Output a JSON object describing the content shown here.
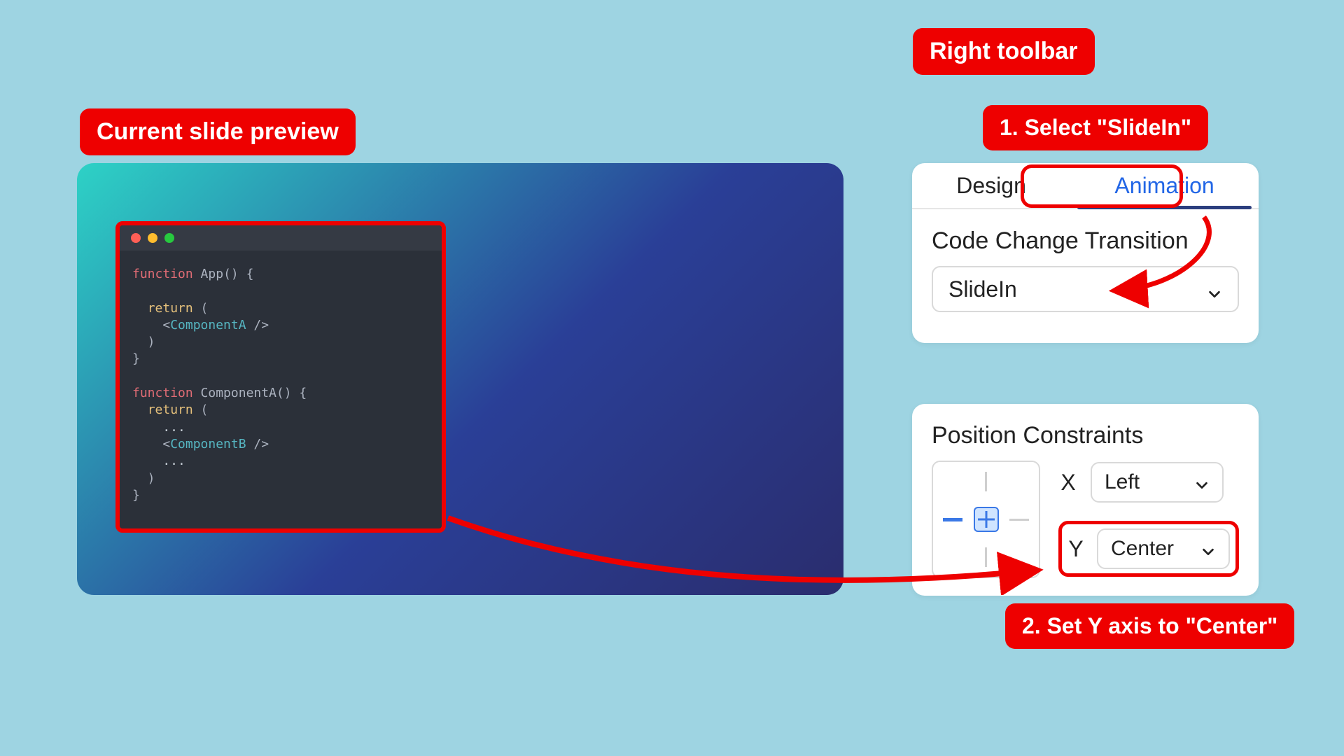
{
  "callouts": {
    "slide_preview": "Current slide preview",
    "right_toolbar": "Right toolbar",
    "step1": "1. Select \"SlideIn\"",
    "step2": "2. Set Y axis to \"Center\""
  },
  "slide": {
    "code_lines": [
      {
        "tokens": [
          {
            "t": "function",
            "c": "tok-kw"
          },
          {
            "t": " ",
            "c": ""
          },
          {
            "t": "App",
            "c": "tok-fn"
          },
          {
            "t": "() {",
            "c": "tok-pun"
          }
        ]
      },
      {
        "tokens": []
      },
      {
        "tokens": [
          {
            "t": "  ",
            "c": ""
          },
          {
            "t": "return",
            "c": "tok-ret"
          },
          {
            "t": " (",
            "c": "tok-pun"
          }
        ]
      },
      {
        "tokens": [
          {
            "t": "    <",
            "c": "tok-pun"
          },
          {
            "t": "ComponentA",
            "c": "tok-tag"
          },
          {
            "t": " />",
            "c": "tok-pun"
          }
        ]
      },
      {
        "tokens": [
          {
            "t": "  )",
            "c": "tok-pun"
          }
        ]
      },
      {
        "tokens": [
          {
            "t": "}",
            "c": "tok-pun"
          }
        ]
      },
      {
        "tokens": []
      },
      {
        "tokens": [
          {
            "t": "function",
            "c": "tok-kw"
          },
          {
            "t": " ",
            "c": ""
          },
          {
            "t": "ComponentA",
            "c": "tok-fn"
          },
          {
            "t": "() {",
            "c": "tok-pun"
          }
        ]
      },
      {
        "tokens": [
          {
            "t": "  ",
            "c": ""
          },
          {
            "t": "return",
            "c": "tok-ret"
          },
          {
            "t": " (",
            "c": "tok-pun"
          }
        ]
      },
      {
        "tokens": [
          {
            "t": "    ...",
            "c": "tok-dot"
          }
        ]
      },
      {
        "tokens": [
          {
            "t": "    <",
            "c": "tok-pun"
          },
          {
            "t": "ComponentB",
            "c": "tok-tag"
          },
          {
            "t": " />",
            "c": "tok-pun"
          }
        ]
      },
      {
        "tokens": [
          {
            "t": "    ...",
            "c": "tok-dot"
          }
        ]
      },
      {
        "tokens": [
          {
            "t": "  )",
            "c": "tok-pun"
          }
        ]
      },
      {
        "tokens": [
          {
            "t": "}",
            "c": "tok-pun"
          }
        ]
      }
    ]
  },
  "toolbar": {
    "tabs": {
      "design": "Design",
      "animation": "Animation",
      "active": "animation"
    },
    "transition": {
      "title": "Code Change Transition",
      "selected": "SlideIn"
    },
    "constraints": {
      "title": "Position Constraints",
      "x": {
        "label": "X",
        "value": "Left"
      },
      "y": {
        "label": "Y",
        "value": "Center"
      }
    }
  },
  "colors": {
    "red": "#ee0000",
    "accent": "#2266e6"
  }
}
